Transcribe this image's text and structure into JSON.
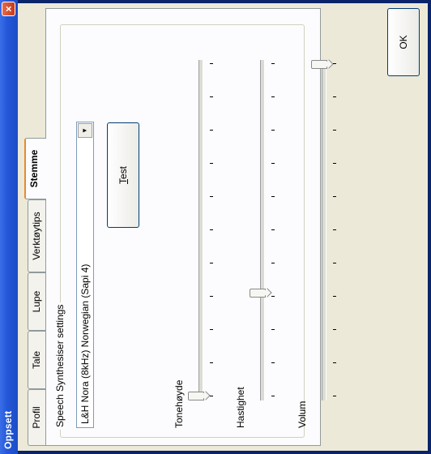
{
  "window": {
    "title": "Oppsett",
    "close_glyph": "×"
  },
  "tabs": [
    {
      "label": "Profil"
    },
    {
      "label": "Tale"
    },
    {
      "label": "Lupe"
    },
    {
      "label": "Verktøytips"
    },
    {
      "label": "Stemme"
    }
  ],
  "active_tab": "Stemme",
  "group": {
    "label": "Speech Synthesiser settings",
    "voice_value": "L&H Nora (8kHz) Norwegian (Sapi 4)",
    "dropdown_glyph": "▼",
    "test_label": "Test",
    "test_mnemonic": "T"
  },
  "sliders": [
    {
      "label": "Tonehøyde",
      "level": 0.0
    },
    {
      "label": "Hastighet",
      "level": 0.31
    },
    {
      "label": "Volum",
      "level": 1.0
    }
  ],
  "ok_label": "OK",
  "colors": {
    "titlebar": "#2457d8",
    "dialog_bg": "#ece9d8",
    "active_tab_accent": "#e68b2c"
  }
}
